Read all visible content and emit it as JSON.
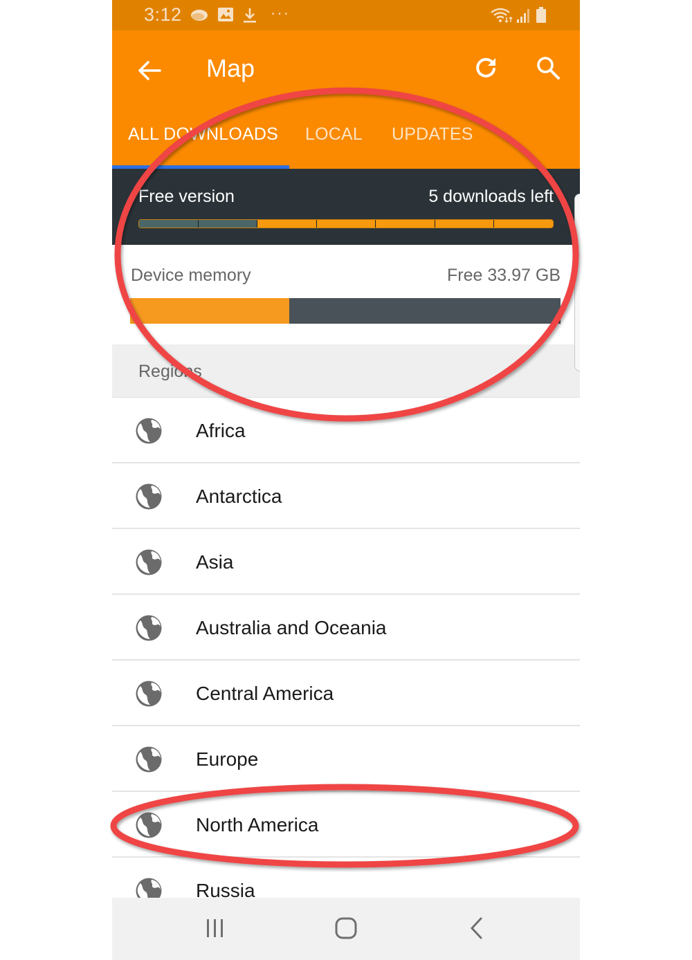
{
  "status_bar": {
    "time": "3:12",
    "more": "···",
    "icons": [
      "chat-bubble-icon",
      "image-icon",
      "download-icon",
      "wifi-icon",
      "signal-icon",
      "battery-icon"
    ]
  },
  "app_bar": {
    "title": "Map",
    "back_icon": "arrow-left-icon",
    "refresh_icon": "refresh-icon",
    "search_icon": "search-icon",
    "background_color": "#fb8a00"
  },
  "tabs": [
    {
      "label": "ALL DOWNLOADS",
      "active": true
    },
    {
      "label": "LOCAL",
      "active": false
    },
    {
      "label": "UPDATES",
      "active": false
    }
  ],
  "free_version": {
    "label": "Free version",
    "downloads_left_text": "5 downloads left",
    "total_downloads": 7,
    "used_downloads": 2,
    "used_color": "#4a6668",
    "remaining_color": "#f7990e"
  },
  "device_memory": {
    "label": "Device memory",
    "free_text": "Free 33.97 GB",
    "used_fraction": 0.37,
    "used_color": "#f6991f",
    "free_color": "#4a5259"
  },
  "regions": {
    "header": "Regions",
    "items": [
      {
        "label": "Africa",
        "icon": "globe-icon"
      },
      {
        "label": "Antarctica",
        "icon": "globe-icon"
      },
      {
        "label": "Asia",
        "icon": "globe-icon"
      },
      {
        "label": "Australia and Oceania",
        "icon": "globe-icon"
      },
      {
        "label": "Central America",
        "icon": "globe-icon"
      },
      {
        "label": "Europe",
        "icon": "globe-icon"
      },
      {
        "label": "North America",
        "icon": "globe-icon",
        "highlighted": true
      },
      {
        "label": "Russia",
        "icon": "globe-icon"
      }
    ]
  },
  "nav_bar": {
    "buttons": [
      "recent-apps",
      "home",
      "back"
    ]
  },
  "annotations": {
    "color": "#ef4444"
  }
}
